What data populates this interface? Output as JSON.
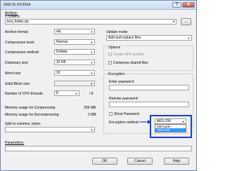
{
  "window": {
    "title": "Add to Archive",
    "help_glyph": "?",
    "close_glyph": "X"
  },
  "archive": {
    "label": "Archive:",
    "path_prefix": "C:\\Users\\",
    "path": "test_folder.zip",
    "browse_label": "..."
  },
  "left": {
    "archive_format_label": "Archive format:",
    "archive_format_value": "zip",
    "compression_level_label": "Compression level:",
    "compression_level_value": "Normal",
    "compression_method_label": "Compression method:",
    "compression_method_value": "Deflate",
    "dictionary_size_label": "Dictionary size:",
    "dictionary_size_value": "32 KB",
    "word_size_label": "Word size:",
    "word_size_value": "32",
    "solid_block_size_label": "Solid Block size:",
    "solid_block_size_value": "",
    "cpu_threads_label": "Number of CPU threads:",
    "cpu_threads_value": "8",
    "cpu_threads_total": "/ 8",
    "mem_compress_label": "Memory usage for Compressing:",
    "mem_compress_value": "259 MB",
    "mem_decompress_label": "Memory usage for Decompressing:",
    "mem_decompress_value": "2 MB",
    "split_label": "Split to volumes, bytes:",
    "split_value": "",
    "params_label": "Parameters:",
    "params_value": ""
  },
  "right": {
    "update_mode_label": "Update mode:",
    "update_mode_value": "Add and replace files",
    "options_label": "Options",
    "sfx_label": "Create SFX archive",
    "compress_shared_label": "Compress shared files",
    "encryption_label": "Encryption",
    "enter_password_label": "Enter password:",
    "reenter_password_label": "Reenter password:",
    "show_password_label": "Show Password",
    "encryption_method_label": "Encryption method:",
    "encryption_method_value": "AES-256",
    "encryption_options": [
      "ZipCrypto",
      "AES-256"
    ]
  },
  "footer": {
    "ok_label": "OK",
    "cancel_label": "Cancel",
    "help_label": "Help"
  },
  "colors": {
    "highlight_border": "#1b3fc9",
    "arrow": "#1b3fc9",
    "selected_option": "#3399ff"
  },
  "icons": {
    "dropdown": "chevron-down-icon",
    "arrow": "right-arrow-icon"
  }
}
